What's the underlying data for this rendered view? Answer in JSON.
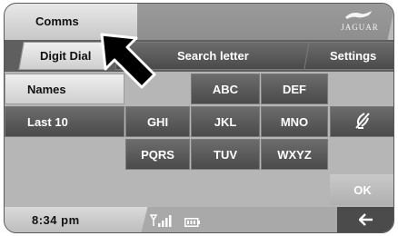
{
  "header": {
    "title": "Comms",
    "brand": "JAGUAR"
  },
  "tabs": {
    "digit_dial": "Digit Dial",
    "search_letter": "Search letter",
    "settings": "Settings"
  },
  "left_menu": {
    "names": "Names",
    "last10": "Last 10"
  },
  "keypad": [
    "ABC",
    "DEF",
    "GHI",
    "JKL",
    "MNO",
    "PQRS",
    "TUV",
    "WXYZ"
  ],
  "ok_label": "OK",
  "status": {
    "time": "8:34 pm"
  },
  "icons": {
    "mute": "microphone-muted-icon",
    "signal": "signal-icon",
    "battery": "battery-icon",
    "back": "back-arrow-icon",
    "pointer": "pointer-arrow-icon"
  }
}
